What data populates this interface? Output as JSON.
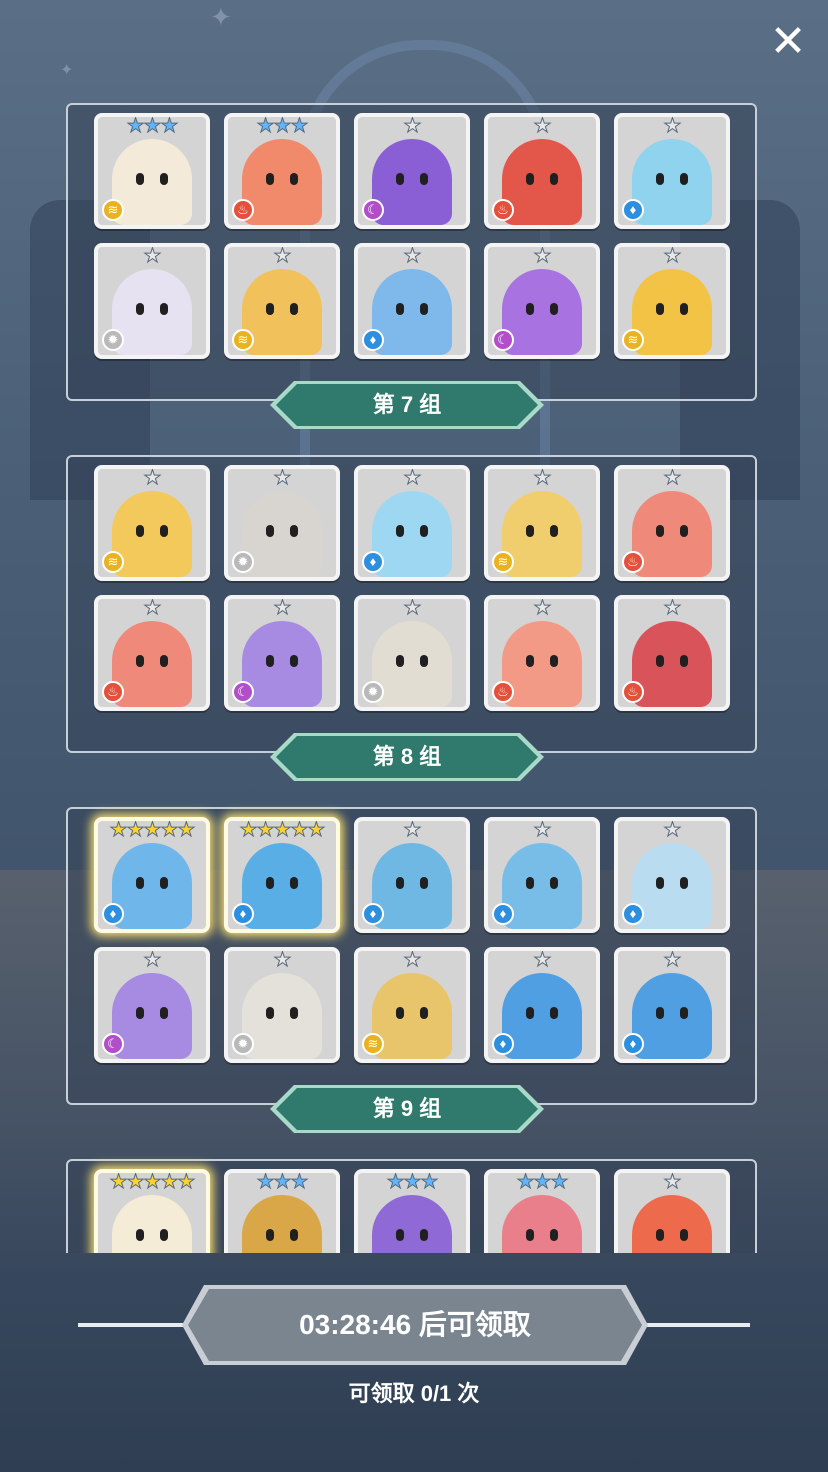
{
  "close_icon_glyph": "✕",
  "groups": [
    {
      "label": "",
      "cards": [
        {
          "stars": "★★★",
          "star_color": "blue",
          "element": "wind",
          "tint": "#f4ead9",
          "char": "rabbit"
        },
        {
          "stars": "★★★",
          "star_color": "blue",
          "element": "fire",
          "tint": "#f08a6a",
          "char": "red-flower-monster"
        },
        {
          "stars": "★",
          "star_color": "grey",
          "element": "dark",
          "tint": "#8a5fd6",
          "char": "purple-puffball"
        },
        {
          "stars": "★",
          "star_color": "grey",
          "element": "fire",
          "tint": "#e2574a",
          "char": "red-tree-stump"
        },
        {
          "stars": "★",
          "star_color": "grey",
          "element": "water",
          "tint": "#8fd3ee",
          "char": "blue-hair-girl"
        },
        {
          "stars": "★",
          "star_color": "grey",
          "element": "light",
          "tint": "#e6e2f2",
          "char": "skull-mask"
        },
        {
          "stars": "★",
          "star_color": "grey",
          "element": "wind",
          "tint": "#f1c25b",
          "char": "cat-guard"
        },
        {
          "stars": "★",
          "star_color": "grey",
          "element": "water",
          "tint": "#7fb8ea",
          "char": "blue-stone-totem"
        },
        {
          "stars": "★",
          "star_color": "grey",
          "element": "dark",
          "tint": "#a872e0",
          "char": "purple-stone-totem"
        },
        {
          "stars": "★",
          "star_color": "grey",
          "element": "wind",
          "tint": "#f2c344",
          "char": "yellow-castle"
        }
      ]
    },
    {
      "label": "第 7 组",
      "cards": [
        {
          "stars": "★",
          "star_color": "grey",
          "element": "wind",
          "tint": "#f2c95a",
          "char": "yellow-puffball"
        },
        {
          "stars": "★",
          "star_color": "grey",
          "element": "light",
          "tint": "#d8d5d1",
          "char": "grey-tree-stump"
        },
        {
          "stars": "★",
          "star_color": "grey",
          "element": "water",
          "tint": "#9dd7f2",
          "char": "blue-cat-kid"
        },
        {
          "stars": "★",
          "star_color": "grey",
          "element": "wind",
          "tint": "#f1ce6d",
          "char": "golden-helmet-kid"
        },
        {
          "stars": "★",
          "star_color": "grey",
          "element": "fire",
          "tint": "#ef8a7a",
          "char": "red-knight"
        },
        {
          "stars": "★",
          "star_color": "grey",
          "element": "fire",
          "tint": "#ef8a7a",
          "char": "red-knight-2"
        },
        {
          "stars": "★",
          "star_color": "grey",
          "element": "dark",
          "tint": "#a78ae2",
          "char": "purple-knight"
        },
        {
          "stars": "★",
          "star_color": "grey",
          "element": "light",
          "tint": "#e2ddd3",
          "char": "beige-castle"
        },
        {
          "stars": "★",
          "star_color": "grey",
          "element": "fire",
          "tint": "#f29a86",
          "char": "red-hair-girl"
        },
        {
          "stars": "★",
          "star_color": "grey",
          "element": "fire",
          "tint": "#d9535a",
          "char": "red-chest-monster"
        }
      ]
    },
    {
      "label": "第 8 组",
      "cards": [
        {
          "stars": "★★★★★",
          "star_color": "gold",
          "element": "water",
          "tint": "#6fb6ea",
          "char": "blue-flame-golem"
        },
        {
          "stars": "★★★★★",
          "star_color": "gold",
          "element": "water",
          "tint": "#5aaee6",
          "char": "one-eye-tree"
        },
        {
          "stars": "★",
          "star_color": "grey",
          "element": "water",
          "tint": "#6fb8e4",
          "char": "blue-cactus"
        },
        {
          "stars": "★",
          "star_color": "grey",
          "element": "water",
          "tint": "#78bde8",
          "char": "spotted-shell"
        },
        {
          "stars": "★",
          "star_color": "grey",
          "element": "water",
          "tint": "#b9dcf0",
          "char": "dark-hair-girl"
        },
        {
          "stars": "★",
          "star_color": "grey",
          "element": "dark",
          "tint": "#a78ae2",
          "char": "purple-knight-2"
        },
        {
          "stars": "★",
          "star_color": "grey",
          "element": "light",
          "tint": "#e4e1da",
          "char": "white-ram-kid"
        },
        {
          "stars": "★",
          "star_color": "grey",
          "element": "wind",
          "tint": "#e8c56a",
          "char": "golden-sword"
        },
        {
          "stars": "★",
          "star_color": "grey",
          "element": "water",
          "tint": "#4f9fe2",
          "char": "bandaged-blue-beast"
        },
        {
          "stars": "★",
          "star_color": "grey",
          "element": "water",
          "tint": "#4f9fe2",
          "char": "bandaged-blue-beast-2"
        }
      ]
    },
    {
      "label": "第 9 组",
      "cards": [
        {
          "stars": "★★★★★",
          "star_color": "gold",
          "element": "light",
          "tint": "#f5ecd8",
          "char": "white-hair-hero"
        },
        {
          "stars": "★★★",
          "star_color": "blue",
          "element": "wind",
          "tint": "#d9a648",
          "char": "horned-helmet"
        },
        {
          "stars": "★★★",
          "star_color": "blue",
          "element": "dark",
          "tint": "#8f6ad6",
          "char": "bandaged-mummy"
        },
        {
          "stars": "★★★",
          "star_color": "blue",
          "element": "fire",
          "tint": "#e87f8a",
          "char": "pink-robot"
        },
        {
          "stars": "★",
          "star_color": "grey",
          "element": "fire",
          "tint": "#ee6a4c",
          "char": "red-bird"
        }
      ]
    }
  ],
  "element_icons": {
    "wind": "≋",
    "fire": "♨",
    "dark": "☾",
    "water": "♦",
    "light": "✹"
  },
  "timer": {
    "text": "03:28:46 后可领取"
  },
  "claim_count": {
    "text": "可领取 0/1 次"
  },
  "colors": {
    "banner": "#2f7a6c",
    "banner_edge": "#a9d9c8",
    "plate": "#7a8590",
    "plate_edge": "#c9ced4"
  }
}
